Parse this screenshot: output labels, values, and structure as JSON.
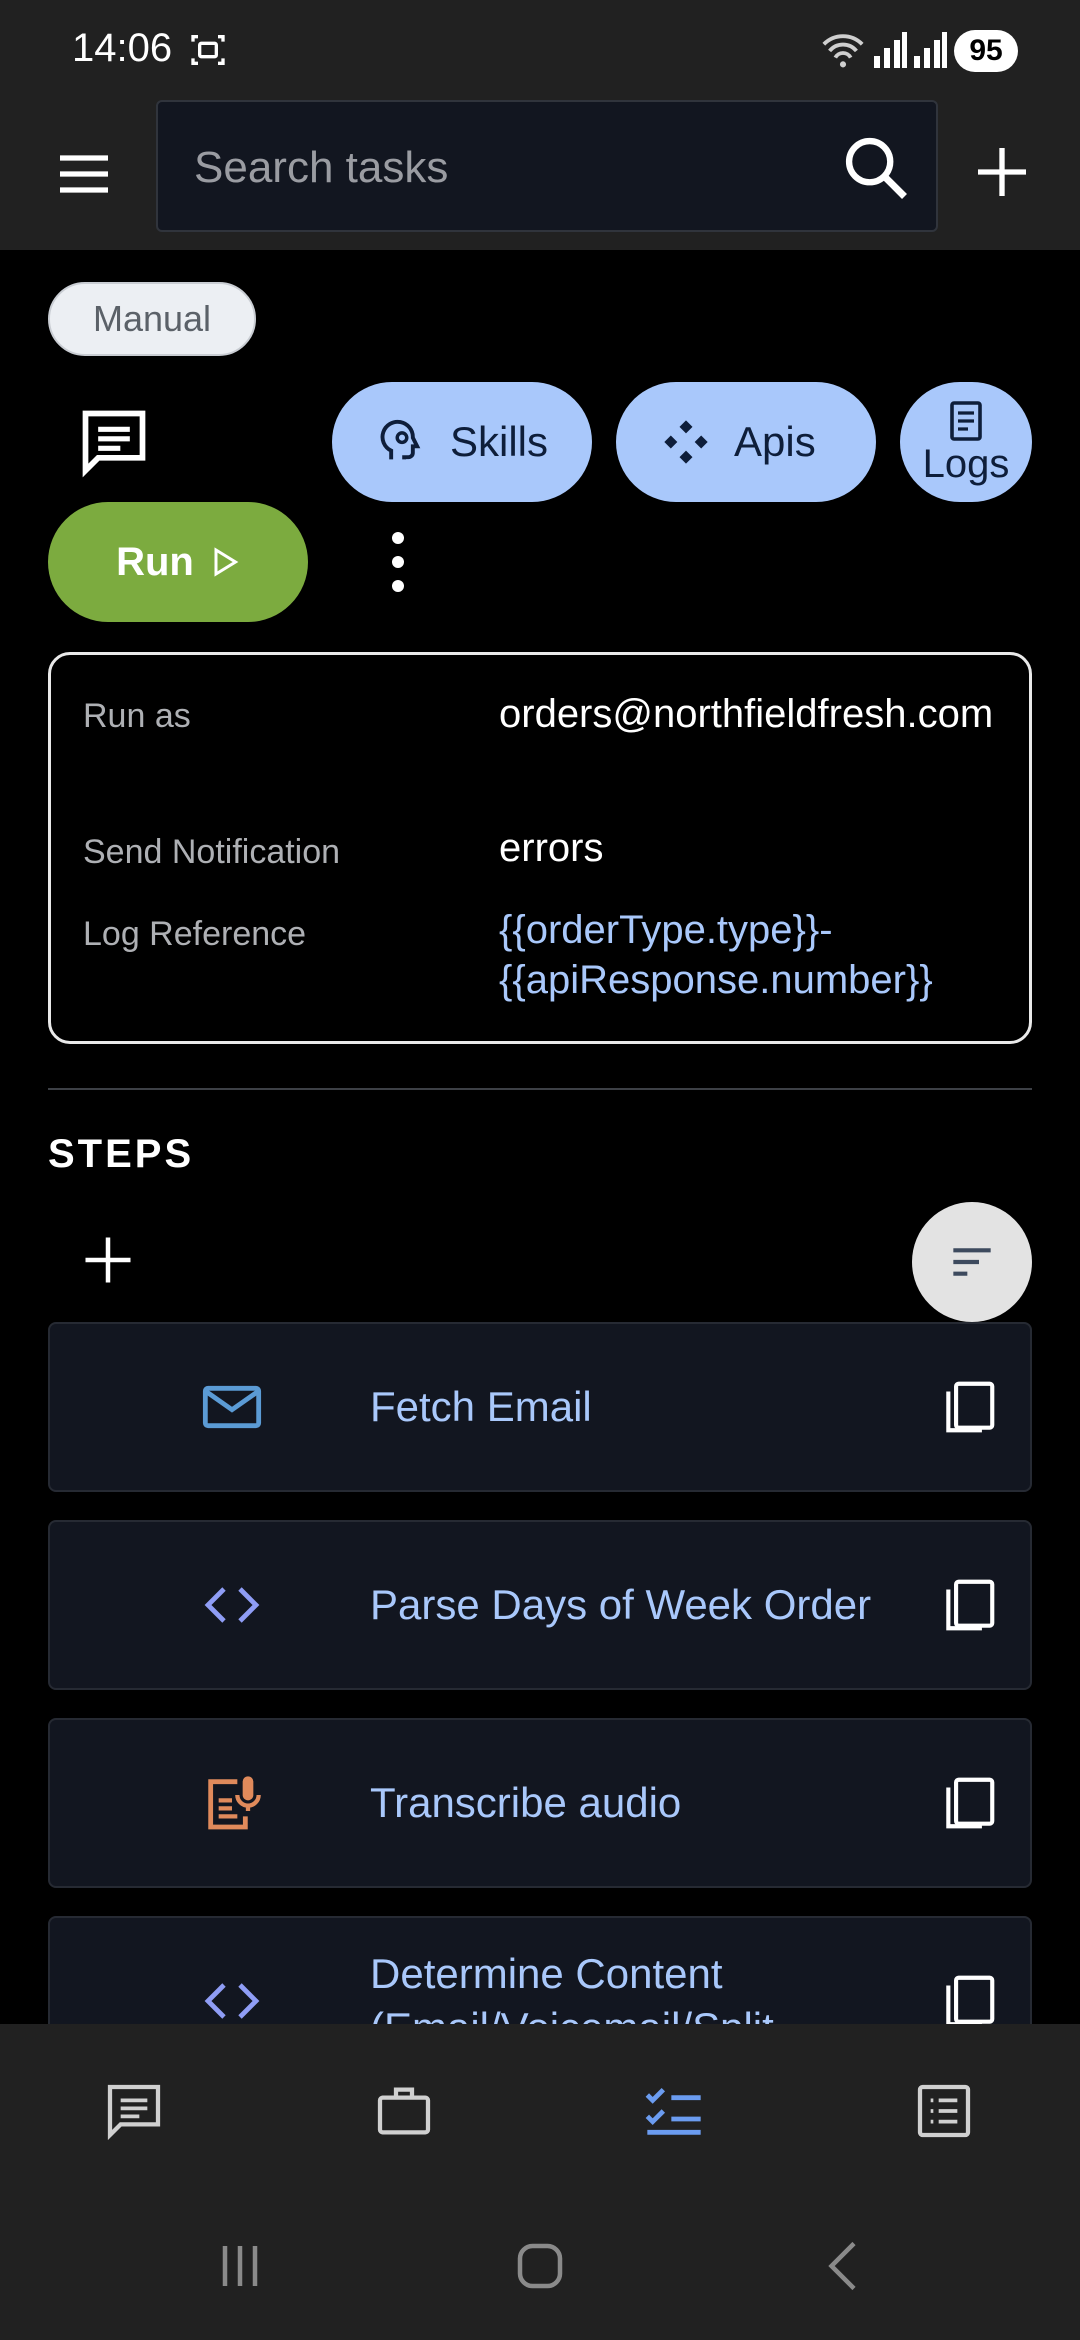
{
  "status_bar": {
    "time": "14:06",
    "battery": "95",
    "icons": [
      "screenshot-icon",
      "wifi-icon",
      "signal-icon",
      "signal-icon-2"
    ]
  },
  "header": {
    "search_placeholder": "Search tasks",
    "icons": [
      "menu-icon",
      "search-icon",
      "add-icon"
    ]
  },
  "task": {
    "mode_chip": "Manual",
    "actions": {
      "skills_label": "Skills",
      "apis_label": "Apis",
      "logs_label": "Logs",
      "run_label": "Run"
    },
    "info": [
      {
        "label": "Run as",
        "value": "orders@northfieldfresh.com"
      },
      {
        "label": "Send Notification",
        "value": "errors"
      },
      {
        "label": "Log Reference",
        "value": "{{orderType.type}}-{{apiResponse.number}}"
      }
    ]
  },
  "steps": {
    "title": "STEPS",
    "items": [
      {
        "label": "Fetch Email",
        "icon": "mail-icon",
        "icon_color": "#5b9bd5"
      },
      {
        "label": "Parse Days of Week Order",
        "icon": "code-icon",
        "icon_color": "#8f9df5"
      },
      {
        "label": "Transcribe audio",
        "icon": "voice-doc-icon",
        "icon_color": "#e08a5b"
      },
      {
        "label": "Determine Content (Email/Voicemail/Split",
        "icon": "code-icon",
        "icon_color": "#8f9df5"
      }
    ]
  },
  "bottom_nav": {
    "items": [
      "chat-icon",
      "briefcase-icon",
      "tasks-icon",
      "list-icon"
    ],
    "active_index": 2,
    "active_color": "#6b9cf0"
  },
  "colors": {
    "accent": "#a9c8fb",
    "run": "#7cab3f",
    "surface": "#212121"
  }
}
